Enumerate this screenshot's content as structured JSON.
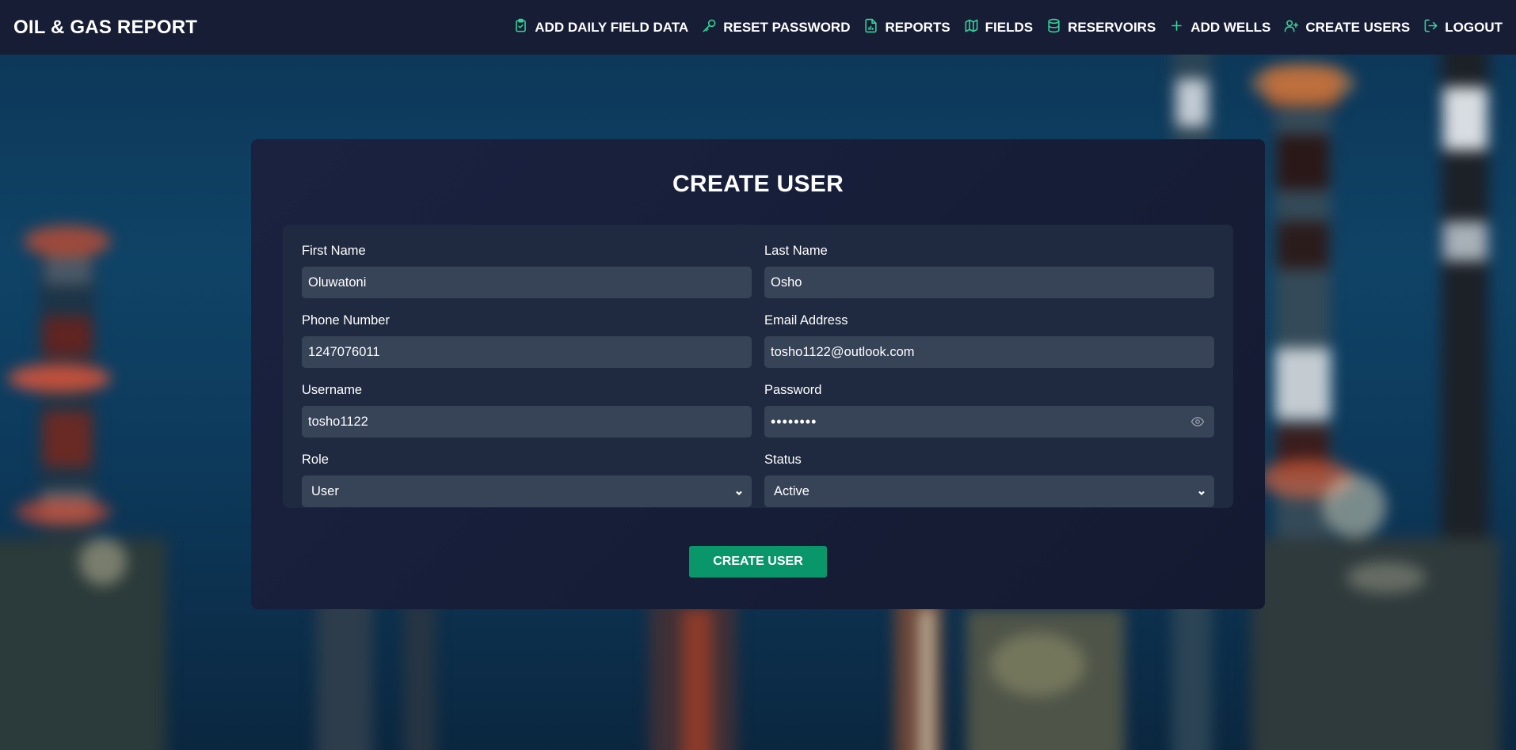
{
  "brand": "OIL & GAS REPORT",
  "nav": [
    {
      "label": "ADD DAILY FIELD DATA",
      "icon": "clipboard-check-icon"
    },
    {
      "label": "RESET PASSWORD",
      "icon": "key-icon"
    },
    {
      "label": "REPORTS",
      "icon": "file-chart-icon"
    },
    {
      "label": "FIELDS",
      "icon": "map-icon"
    },
    {
      "label": "RESERVOIRS",
      "icon": "database-icon"
    },
    {
      "label": "ADD WELLS",
      "icon": "plus-icon"
    },
    {
      "label": "CREATE USERS",
      "icon": "user-plus-icon"
    },
    {
      "label": "LOGOUT",
      "icon": "logout-icon"
    }
  ],
  "form": {
    "title": "CREATE USER",
    "first_name": {
      "label": "First Name",
      "value": "Oluwatoni"
    },
    "last_name": {
      "label": "Last Name",
      "value": "Osho"
    },
    "phone": {
      "label": "Phone Number",
      "value": "1247076011"
    },
    "email": {
      "label": "Email Address",
      "value": "tosho1122@outlook.com"
    },
    "username": {
      "label": "Username",
      "value": "tosho1122"
    },
    "password": {
      "label": "Password",
      "value": "••••••••"
    },
    "role": {
      "label": "Role",
      "value": "User"
    },
    "status": {
      "label": "Status",
      "value": "Active"
    },
    "submit_label": "CREATE USER"
  },
  "colors": {
    "nav_bg": "#171d35",
    "accent": "#34d399",
    "button": "#099669",
    "input_bg": "#374357"
  }
}
